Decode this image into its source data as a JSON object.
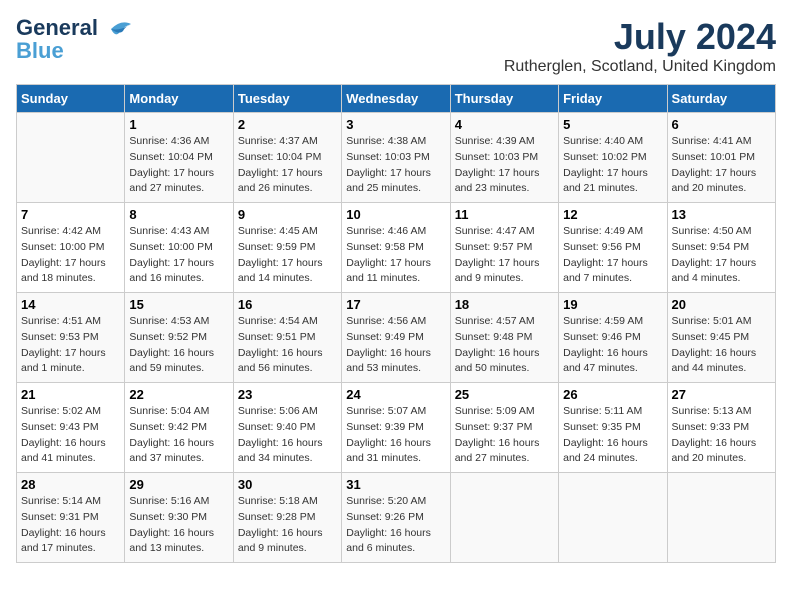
{
  "header": {
    "logo_line1": "General",
    "logo_line2": "Blue",
    "month_year": "July 2024",
    "location": "Rutherglen, Scotland, United Kingdom"
  },
  "days_of_week": [
    "Sunday",
    "Monday",
    "Tuesday",
    "Wednesday",
    "Thursday",
    "Friday",
    "Saturday"
  ],
  "weeks": [
    [
      {
        "day": "",
        "info": ""
      },
      {
        "day": "1",
        "info": "Sunrise: 4:36 AM\nSunset: 10:04 PM\nDaylight: 17 hours\nand 27 minutes."
      },
      {
        "day": "2",
        "info": "Sunrise: 4:37 AM\nSunset: 10:04 PM\nDaylight: 17 hours\nand 26 minutes."
      },
      {
        "day": "3",
        "info": "Sunrise: 4:38 AM\nSunset: 10:03 PM\nDaylight: 17 hours\nand 25 minutes."
      },
      {
        "day": "4",
        "info": "Sunrise: 4:39 AM\nSunset: 10:03 PM\nDaylight: 17 hours\nand 23 minutes."
      },
      {
        "day": "5",
        "info": "Sunrise: 4:40 AM\nSunset: 10:02 PM\nDaylight: 17 hours\nand 21 minutes."
      },
      {
        "day": "6",
        "info": "Sunrise: 4:41 AM\nSunset: 10:01 PM\nDaylight: 17 hours\nand 20 minutes."
      }
    ],
    [
      {
        "day": "7",
        "info": "Sunrise: 4:42 AM\nSunset: 10:00 PM\nDaylight: 17 hours\nand 18 minutes."
      },
      {
        "day": "8",
        "info": "Sunrise: 4:43 AM\nSunset: 10:00 PM\nDaylight: 17 hours\nand 16 minutes."
      },
      {
        "day": "9",
        "info": "Sunrise: 4:45 AM\nSunset: 9:59 PM\nDaylight: 17 hours\nand 14 minutes."
      },
      {
        "day": "10",
        "info": "Sunrise: 4:46 AM\nSunset: 9:58 PM\nDaylight: 17 hours\nand 11 minutes."
      },
      {
        "day": "11",
        "info": "Sunrise: 4:47 AM\nSunset: 9:57 PM\nDaylight: 17 hours\nand 9 minutes."
      },
      {
        "day": "12",
        "info": "Sunrise: 4:49 AM\nSunset: 9:56 PM\nDaylight: 17 hours\nand 7 minutes."
      },
      {
        "day": "13",
        "info": "Sunrise: 4:50 AM\nSunset: 9:54 PM\nDaylight: 17 hours\nand 4 minutes."
      }
    ],
    [
      {
        "day": "14",
        "info": "Sunrise: 4:51 AM\nSunset: 9:53 PM\nDaylight: 17 hours\nand 1 minute."
      },
      {
        "day": "15",
        "info": "Sunrise: 4:53 AM\nSunset: 9:52 PM\nDaylight: 16 hours\nand 59 minutes."
      },
      {
        "day": "16",
        "info": "Sunrise: 4:54 AM\nSunset: 9:51 PM\nDaylight: 16 hours\nand 56 minutes."
      },
      {
        "day": "17",
        "info": "Sunrise: 4:56 AM\nSunset: 9:49 PM\nDaylight: 16 hours\nand 53 minutes."
      },
      {
        "day": "18",
        "info": "Sunrise: 4:57 AM\nSunset: 9:48 PM\nDaylight: 16 hours\nand 50 minutes."
      },
      {
        "day": "19",
        "info": "Sunrise: 4:59 AM\nSunset: 9:46 PM\nDaylight: 16 hours\nand 47 minutes."
      },
      {
        "day": "20",
        "info": "Sunrise: 5:01 AM\nSunset: 9:45 PM\nDaylight: 16 hours\nand 44 minutes."
      }
    ],
    [
      {
        "day": "21",
        "info": "Sunrise: 5:02 AM\nSunset: 9:43 PM\nDaylight: 16 hours\nand 41 minutes."
      },
      {
        "day": "22",
        "info": "Sunrise: 5:04 AM\nSunset: 9:42 PM\nDaylight: 16 hours\nand 37 minutes."
      },
      {
        "day": "23",
        "info": "Sunrise: 5:06 AM\nSunset: 9:40 PM\nDaylight: 16 hours\nand 34 minutes."
      },
      {
        "day": "24",
        "info": "Sunrise: 5:07 AM\nSunset: 9:39 PM\nDaylight: 16 hours\nand 31 minutes."
      },
      {
        "day": "25",
        "info": "Sunrise: 5:09 AM\nSunset: 9:37 PM\nDaylight: 16 hours\nand 27 minutes."
      },
      {
        "day": "26",
        "info": "Sunrise: 5:11 AM\nSunset: 9:35 PM\nDaylight: 16 hours\nand 24 minutes."
      },
      {
        "day": "27",
        "info": "Sunrise: 5:13 AM\nSunset: 9:33 PM\nDaylight: 16 hours\nand 20 minutes."
      }
    ],
    [
      {
        "day": "28",
        "info": "Sunrise: 5:14 AM\nSunset: 9:31 PM\nDaylight: 16 hours\nand 17 minutes."
      },
      {
        "day": "29",
        "info": "Sunrise: 5:16 AM\nSunset: 9:30 PM\nDaylight: 16 hours\nand 13 minutes."
      },
      {
        "day": "30",
        "info": "Sunrise: 5:18 AM\nSunset: 9:28 PM\nDaylight: 16 hours\nand 9 minutes."
      },
      {
        "day": "31",
        "info": "Sunrise: 5:20 AM\nSunset: 9:26 PM\nDaylight: 16 hours\nand 6 minutes."
      },
      {
        "day": "",
        "info": ""
      },
      {
        "day": "",
        "info": ""
      },
      {
        "day": "",
        "info": ""
      }
    ]
  ]
}
